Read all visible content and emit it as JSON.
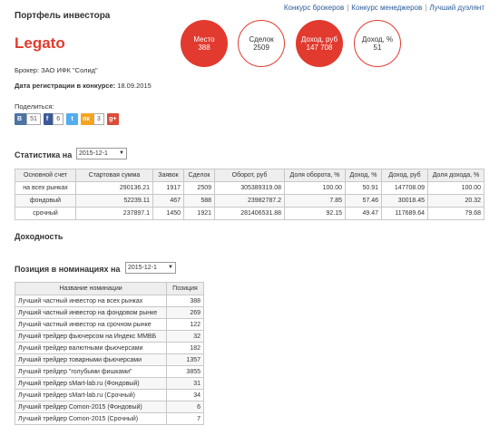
{
  "nav": {
    "links": [
      "Конкурс брокеров",
      "Конкурс менеджеров",
      "Лучший дуэлянт"
    ],
    "separator": "|"
  },
  "header": {
    "title": "Портфель инвестора",
    "nick": "Legato",
    "broker_label": "Брокер:",
    "broker_value": "ЗАО ИФК \"Солид\"",
    "regdate_label": "Дата регистрации в конкурсе:",
    "regdate_value": "18.09.2015"
  },
  "stats_circles": [
    {
      "label": "Место",
      "value": "388"
    },
    {
      "label": "Сделок",
      "value": "2509"
    },
    {
      "label": "Доход, руб",
      "value": "147 708"
    },
    {
      "label": "Доход, %",
      "value": "51"
    }
  ],
  "share": {
    "label": "Поделиться:",
    "buttons": [
      {
        "icon": "vk-icon",
        "text": "В",
        "count": "51",
        "color": "#4c75a3"
      },
      {
        "icon": "facebook-icon",
        "text": "f",
        "count": "6",
        "color": "#3b5998"
      },
      {
        "icon": "twitter-icon",
        "text": "t",
        "count": "",
        "color": "#55acee"
      },
      {
        "icon": "odnoklassniki-icon",
        "text": "ок",
        "count": "3",
        "color": "#f4a422"
      },
      {
        "icon": "googleplus-icon",
        "text": "g+",
        "count": "",
        "color": "#dd4b39"
      }
    ]
  },
  "stats": {
    "title": "Статистика на",
    "date": "2015-12-1",
    "columns": [
      "Основной счет",
      "Стартовая сумма",
      "Заявок",
      "Сделок",
      "Оборот, руб",
      "Доля оборота, %",
      "Доход, %",
      "Доход, руб",
      "Доля дохода, %"
    ],
    "rows": [
      [
        "на всех рынках",
        "290136.21",
        "1917",
        "2509",
        "305389319.08",
        "100.00",
        "50.91",
        "147708.09",
        "100.00"
      ],
      [
        "фондовый",
        "52239.11",
        "467",
        "588",
        "23982787.2",
        "7.85",
        "57.46",
        "30018.45",
        "20.32"
      ],
      [
        "срочный",
        "237897.1",
        "1450",
        "1921",
        "281406531.88",
        "92.15",
        "49.47",
        "117689.64",
        "79.68"
      ]
    ]
  },
  "income": {
    "title": "Доходность"
  },
  "nominations": {
    "title": "Позиция в номинациях на",
    "date": "2015-12-1",
    "columns": [
      "Название номинации",
      "Позиция"
    ],
    "rows": [
      [
        "Лучший частный инвестор на всех рынках",
        "388"
      ],
      [
        "Лучший частный инвестор на фондовом рынке",
        "269"
      ],
      [
        "Лучший частный инвестор на срочном рынке",
        "122"
      ],
      [
        "Лучший трейдер фьючерсом на Индекс ММВБ",
        "32"
      ],
      [
        "Лучший трейдер валютными фьючерсами",
        "182"
      ],
      [
        "Лучший трейдер товарными фьючерсами",
        "1357"
      ],
      [
        "Лучший трейдер \"голубыми фишками\"",
        "3855"
      ],
      [
        "Лучший трейдер sMart-lab.ru (Фондовый)",
        "31"
      ],
      [
        "Лучший трейдер sMart-lab.ru (Срочный)",
        "34"
      ],
      [
        "Лучший трейдер Comon-2015 (Фондовый)",
        "6"
      ],
      [
        "Лучший трейдер Comon-2015 (Срочный)",
        "7"
      ]
    ]
  }
}
